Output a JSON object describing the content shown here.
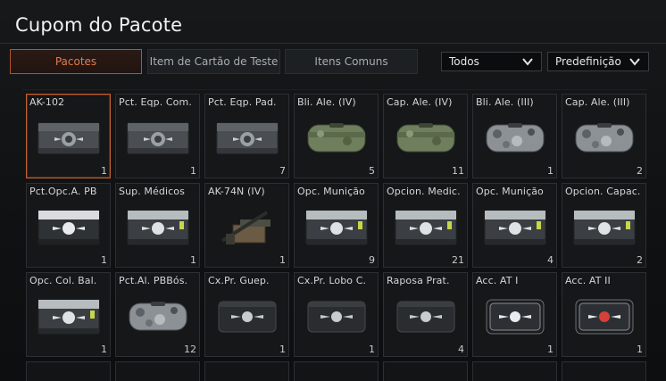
{
  "title": "Cupom do Pacote",
  "tabs": [
    "Pacotes",
    "Item de Cartão de Teste",
    "Itens Comuns"
  ],
  "filters": [
    "Todos",
    "Predefinição"
  ],
  "items": [
    {
      "name": "AK-102",
      "qty": "1",
      "icon": "metal-crate-icon"
    },
    {
      "name": "Pct. Eqp. Com.",
      "qty": "1",
      "icon": "metal-crate-icon"
    },
    {
      "name": "Pct. Eqp. Pad.",
      "qty": "7",
      "icon": "metal-crate-icon"
    },
    {
      "name": "Bli. Ale. (IV)",
      "qty": "5",
      "icon": "green-bag-icon"
    },
    {
      "name": "Cap. Ale. (IV)",
      "qty": "11",
      "icon": "green-bag-icon"
    },
    {
      "name": "Bli. Ale. (III)",
      "qty": "1",
      "icon": "camo-bag-icon"
    },
    {
      "name": "Cap. Ale. (III)",
      "qty": "2",
      "icon": "camo-bag-icon"
    },
    {
      "name": "Pct.Opc.A. PB",
      "qty": "1",
      "icon": "white-crate-icon"
    },
    {
      "name": "Sup. Médicos",
      "qty": "1",
      "icon": "green-crate-icon"
    },
    {
      "name": "AK-74N (IV)",
      "qty": "1",
      "icon": "rifle-icon"
    },
    {
      "name": "Opc. Munição",
      "qty": "9",
      "icon": "green-crate-icon"
    },
    {
      "name": "Opcion. Medic.",
      "qty": "21",
      "icon": "green-crate-icon"
    },
    {
      "name": "Opc. Munição",
      "qty": "4",
      "icon": "green-crate-icon"
    },
    {
      "name": "Opcion. Capac.",
      "qty": "2",
      "icon": "green-crate-icon"
    },
    {
      "name": "Opc. Col. Bal.",
      "qty": "1",
      "icon": "green-crate-icon"
    },
    {
      "name": "Pct.Al. PBBós.",
      "qty": "12",
      "icon": "camo-bag-icon"
    },
    {
      "name": "Cx.Pr. Guep.",
      "qty": "1",
      "icon": "dark-case-icon"
    },
    {
      "name": "Cx.Pr. Lobo C.",
      "qty": "1",
      "icon": "dark-case-icon"
    },
    {
      "name": "Raposa Prat.",
      "qty": "4",
      "icon": "dark-case-icon"
    },
    {
      "name": "Acc. AT I",
      "qty": "1",
      "icon": "clear-case-icon"
    },
    {
      "name": "Acc. AT II",
      "qty": "1",
      "icon": "red-case-icon"
    }
  ]
}
